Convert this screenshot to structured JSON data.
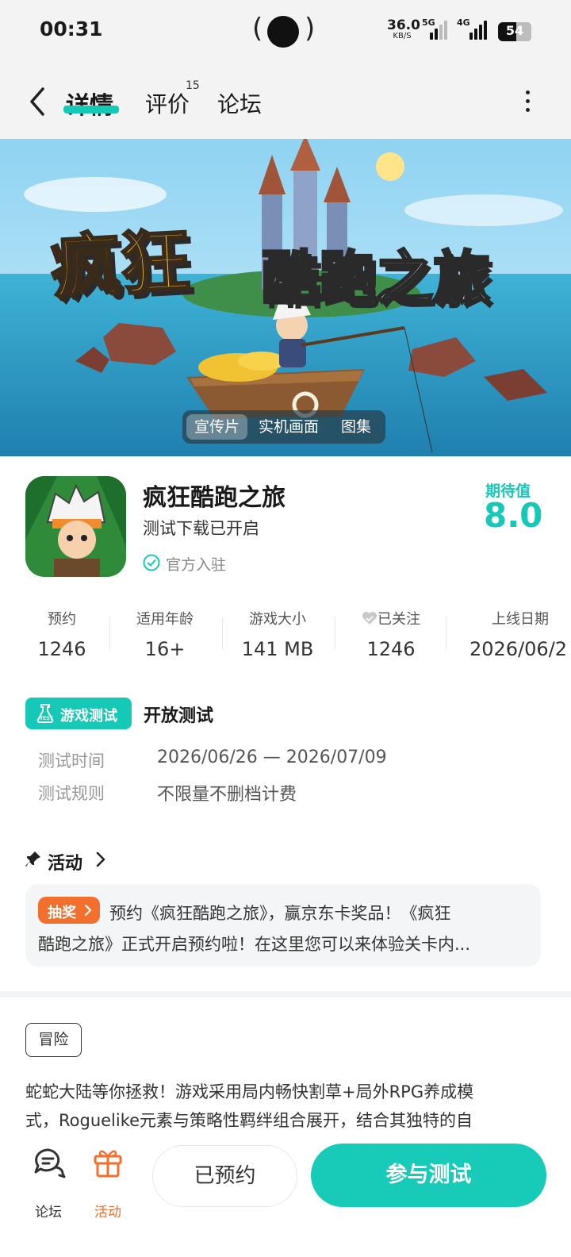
{
  "status_bar": {
    "time": "00:31",
    "speed_value": "36.0",
    "speed_unit": "KB/S",
    "net1": "5G",
    "net2": "4G",
    "battery": "54",
    "battery_level_percent": 54
  },
  "nav": {
    "tabs": [
      {
        "label": "详情",
        "active": true
      },
      {
        "label": "评价",
        "badge": "15"
      },
      {
        "label": "论坛"
      }
    ]
  },
  "banner": {
    "title_part1": "疯狂",
    "title_part2": "酷跑之旅",
    "media_tabs": [
      {
        "label": "宣传片",
        "active": true
      },
      {
        "label": "实机画面"
      },
      {
        "label": "图集"
      }
    ]
  },
  "app": {
    "name": "疯狂酷跑之旅",
    "status": "测试下载已开启",
    "official": "官方入驻",
    "expect_label": "期待值",
    "expect_value": "8.0"
  },
  "stats": [
    {
      "label": "预约",
      "value": "1246"
    },
    {
      "label": "适用年龄",
      "value": "16+"
    },
    {
      "label": "游戏大小",
      "value": "141 MB"
    },
    {
      "label": "已关注",
      "value": "1246"
    },
    {
      "label": "上线日期",
      "value": "2026/06/2"
    }
  ],
  "test": {
    "badge": "游戏测试",
    "badge_icon_text": "TEST",
    "type": "开放测试",
    "time_key": "测试时间",
    "time_val": "2026/06/26 — 2026/07/09",
    "rule_key": "测试规则",
    "rule_val": "不限量不删档计费"
  },
  "activity": {
    "title": "活动",
    "tag": "抽奖",
    "line1": "预约《疯狂酷跑之旅》，赢京东卡奖品！《疯狂",
    "line2": "酷跑之旅》正式开启预约啦！在这里您可以来体验关卡内..."
  },
  "description": {
    "genre": "冒险",
    "line1": "蛇蛇大陆等你拯救！游戏采用局内畅快割草+局外RPG养成模",
    "line2": "式，Roguelike元素与策略性羁绊组合展开，结合其独特的自"
  },
  "bottom": {
    "forum": "论坛",
    "activity": "活动",
    "reserved": "已预约",
    "join": "参与测试"
  },
  "colors": {
    "accent": "#16c8b6",
    "orange": "#f36f2e",
    "banner_title_yellow": "#f6c231"
  }
}
